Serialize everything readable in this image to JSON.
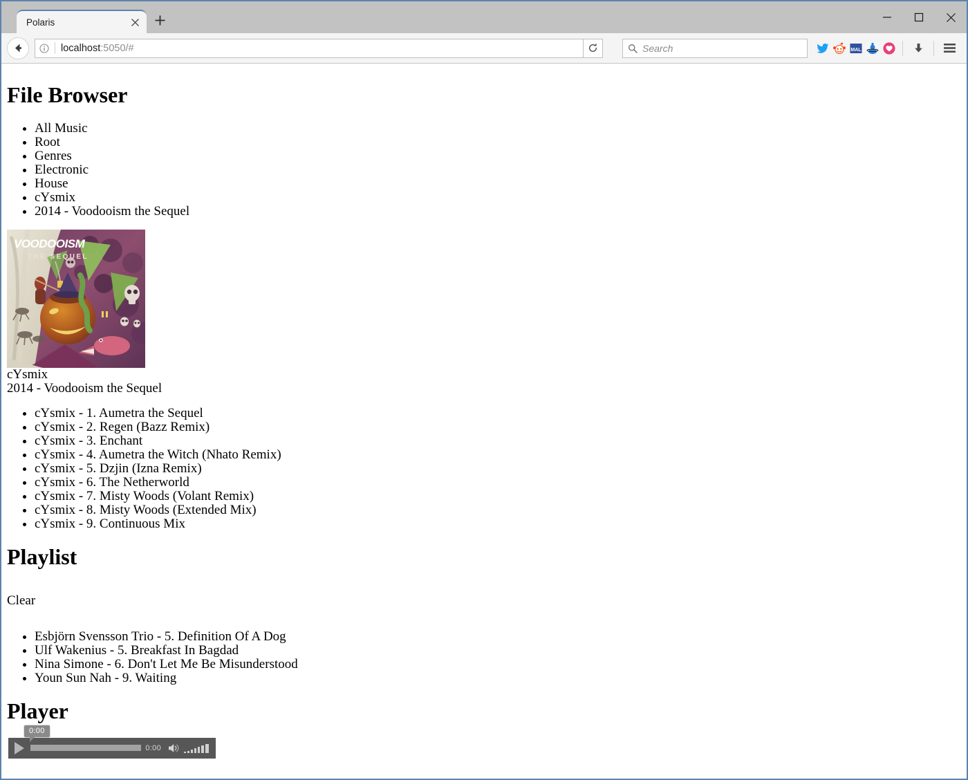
{
  "window": {
    "minimize_label": "Minimize",
    "maximize_label": "Maximize",
    "close_label": "Close"
  },
  "browser": {
    "tab": {
      "title": "Polaris",
      "close_label": "Close tab"
    },
    "new_tab_label": "+",
    "url": {
      "host": "localhost",
      "rest": ":5050/#",
      "full": "localhost:5050/#"
    },
    "search": {
      "placeholder": "Search"
    },
    "icons": [
      {
        "name": "twitter-icon",
        "color": "#1da1f2"
      },
      {
        "name": "reddit-icon",
        "color": "#ff4500"
      },
      {
        "name": "mal-icon",
        "color": "#2e51a2",
        "label": "MAL"
      },
      {
        "name": "anime-planet-icon",
        "color": "#2e7bd4"
      },
      {
        "name": "kitsu-icon",
        "color": "#e7417a"
      },
      {
        "name": "downloads-icon",
        "color": "#4a4a4a"
      },
      {
        "name": "menu-icon",
        "color": "#4a4a4a"
      }
    ]
  },
  "page": {
    "file_browser": {
      "heading": "File Browser",
      "breadcrumbs": [
        "All Music",
        "Root",
        "Genres",
        "Electronic",
        "House",
        "cYsmix",
        "2014 - Voodooism the Sequel"
      ]
    },
    "album": {
      "cover_alt": "Voodooism the Sequel album cover",
      "cover_title": "VOODOOISM",
      "cover_subtitle": "THE SEQUEL",
      "artist": "cYsmix",
      "title": "2014 - Voodooism the Sequel",
      "tracks": [
        "cYsmix - 1. Aumetra the Sequel",
        "cYsmix - 2. Regen (Bazz Remix)",
        "cYsmix - 3. Enchant",
        "cYsmix - 4. Aumetra the Witch (Nhato Remix)",
        "cYsmix - 5. Dzjin (Izna Remix)",
        "cYsmix - 6. The Netherworld",
        "cYsmix - 7. Misty Woods (Volant Remix)",
        "cYsmix - 8. Misty Woods (Extended Mix)",
        "cYsmix - 9. Continuous Mix"
      ]
    },
    "playlist": {
      "heading": "Playlist",
      "clear_label": "Clear",
      "items": [
        "Esbjörn Svensson Trio - 5. Definition Of A Dog",
        "Ulf Wakenius - 5. Breakfast In Bagdad",
        "Nina Simone - 6. Don't Let Me Be Misunderstood",
        "Youn Sun Nah - 9. Waiting"
      ]
    },
    "player": {
      "heading": "Player",
      "play_label": "Play",
      "tooltip_time": "0:00",
      "current_time": "0:00",
      "mute_label": "Mute",
      "volume_label": "Volume"
    }
  }
}
